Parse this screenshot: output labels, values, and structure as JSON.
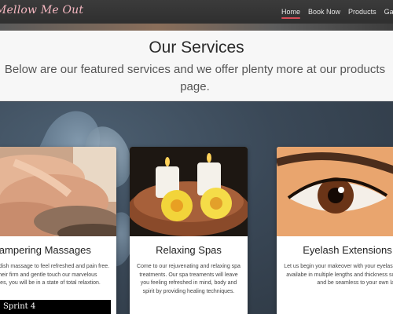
{
  "navbar": {
    "brand": "Mellow Me Out",
    "items": [
      {
        "label": "Home",
        "active": true
      },
      {
        "label": "Book Now",
        "active": false
      },
      {
        "label": "Products",
        "active": false
      },
      {
        "label": "Gallery",
        "active": false
      }
    ]
  },
  "services": {
    "title": "Our Services",
    "subtitle": "Below are our featured services and we offer plenty more at our products page."
  },
  "cards": [
    {
      "title": "Pampering Massages",
      "text": "Enjoy a swedish massage to feel refreshed and pain free. Using their firm and gentle touch our marvelous masseuses, you will be in a state of total relaxtion."
    },
    {
      "title": "Relaxing Spas",
      "text": "Come to our rejuvenating and relaxing spa treatments. Our spa treaments will leave you feeling refreshed in mind, body and spirit by providing healing techniques."
    },
    {
      "title": "Eyelash Extensions",
      "text": "Let us begin your makeover with your eyelashes. Our lashes are availabe in multiple lengths and thickness so it will look natural and be seamless to your own lashes."
    }
  ],
  "footer_label": "Sprint 4",
  "colors": {
    "navbar": "#333333",
    "brand": "#f4b7c0",
    "active_underline": "#d44a55",
    "panel": "#f7f7f7",
    "background": "#3a4450"
  }
}
